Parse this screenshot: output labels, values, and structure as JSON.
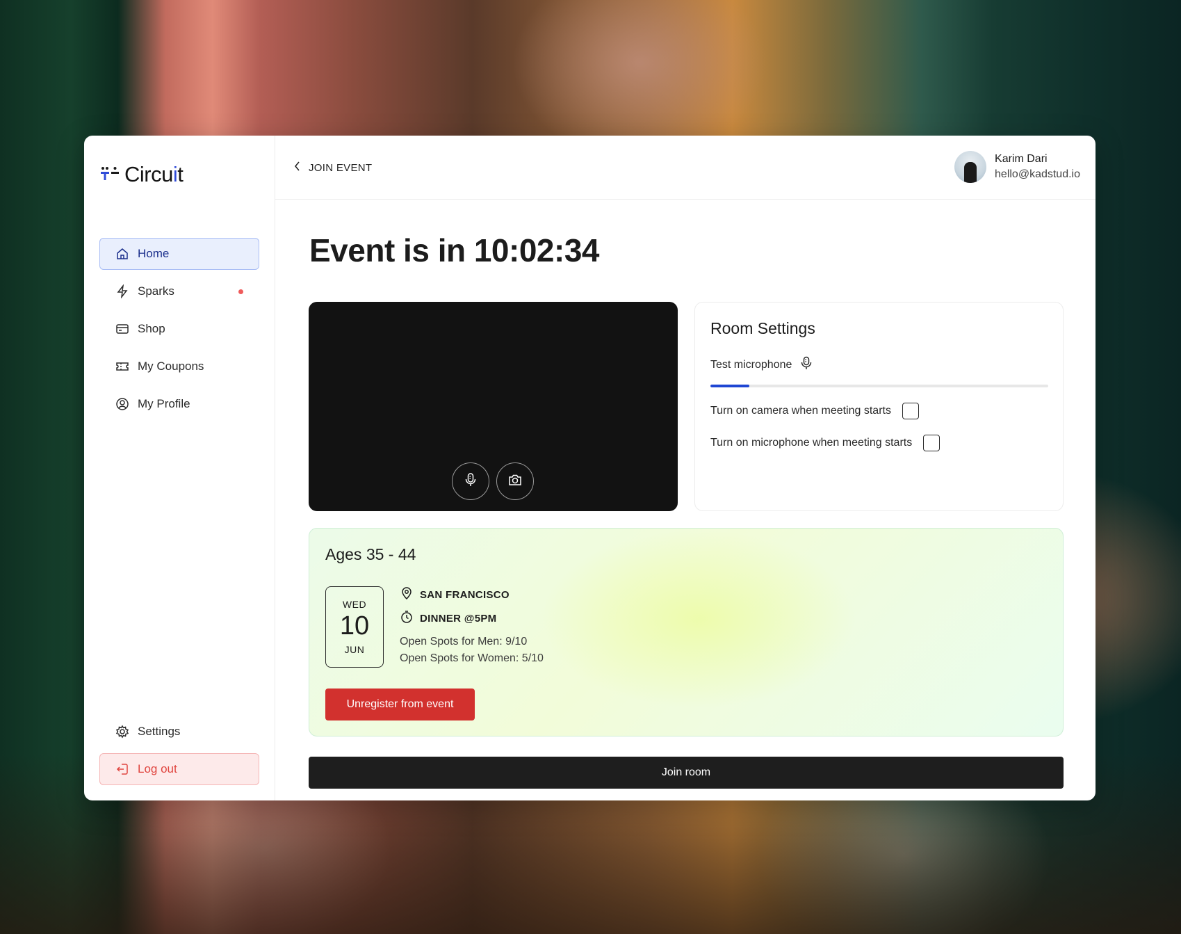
{
  "app": {
    "logo_text_main": "Circu",
    "logo_text_accent": "i",
    "logo_text_end": "t",
    "accent_color": "#2f4bd8"
  },
  "sidebar": {
    "items": [
      {
        "label": "Home",
        "icon": "home-icon",
        "active": true
      },
      {
        "label": "Sparks",
        "icon": "lightning-icon",
        "badge": "notification-dot"
      },
      {
        "label": "Shop",
        "icon": "shop-icon"
      },
      {
        "label": "My Coupons",
        "icon": "coupon-icon"
      },
      {
        "label": "My Profile",
        "icon": "profile-icon"
      }
    ],
    "settings_label": "Settings",
    "logout_label": "Log out"
  },
  "header": {
    "back_label": "JOIN EVENT",
    "user_name": "Karim Dari",
    "user_email": "hello@kadstud.io"
  },
  "main": {
    "title": "Event is in 10:02:34"
  },
  "room_settings": {
    "title": "Room Settings",
    "test_mic_label": "Test microphone",
    "mic_level": 0.115,
    "camera_option": "Turn on camera when meeting starts",
    "camera_checked": false,
    "mic_option": "Turn on microphone when meeting starts",
    "mic_checked": false
  },
  "event": {
    "ages": "Ages 35 - 44",
    "date_dow": "WED",
    "date_day": "10",
    "date_month": "JUN",
    "location": "SAN FRANCISCO",
    "time": "DINNER @5PM",
    "spots_men": "Open Spots for Men: 9/10",
    "spots_women": "Open Spots for Women: 5/10",
    "unregister_label": "Unregister from event"
  },
  "join_label": "Join room"
}
